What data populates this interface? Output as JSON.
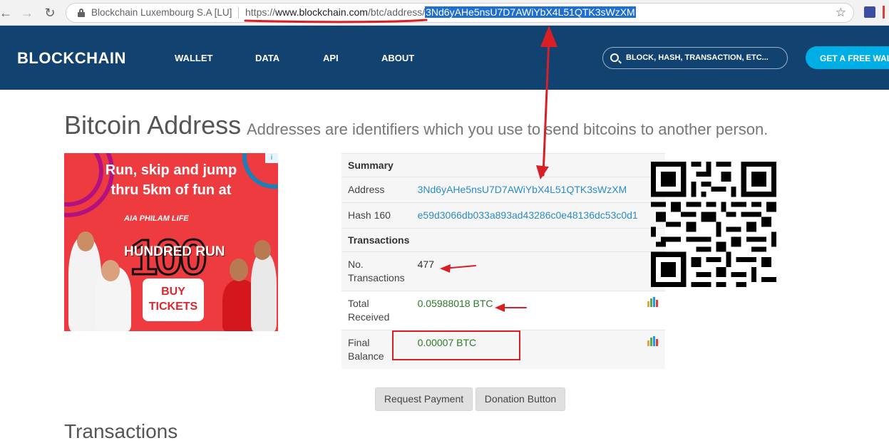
{
  "browser": {
    "site_identity": "Blockchain Luxembourg S.A [LU]",
    "url_scheme": "https://",
    "url_host": "www.blockchain.com",
    "url_path": "/btc/address/",
    "url_selected": "3Nd6yAHe5nsU7D7AWiYbX4L51QTK3sWzXM",
    "back_glyph": "←",
    "forward_glyph": "→",
    "reload_glyph": "↻",
    "star_glyph": "☆"
  },
  "header": {
    "brand": "BLOCKCHAIN",
    "nav": [
      "WALLET",
      "DATA",
      "API",
      "ABOUT"
    ],
    "search_placeholder": "BLOCK, HASH, TRANSACTION, ETC...",
    "cta": "GET A FREE WALLET",
    "bg_color": "#114270",
    "cta_color": "#00aee6"
  },
  "page": {
    "title": "Bitcoin Address",
    "subtitle": "Addresses are identifiers which you use to send bitcoins to another person.",
    "next_heading": "Transactions"
  },
  "ad": {
    "headline_1": "Run, skip and jump",
    "headline_2": "thru 5km of fun at",
    "brand": "AIA PHILAM LIFE",
    "number": "100",
    "event": "HUNDRED RUN",
    "cta_1": "BUY",
    "cta_2": "TICKETS",
    "adchoices": "i"
  },
  "summary": {
    "header": "Summary",
    "address_label": "Address",
    "address_value": "3Nd6yAHe5nsU7D7AWiYbX4L51QTK3sWzXM",
    "hash_label": "Hash 160",
    "hash_value": "e59d3066db033a893ad43286c0e48136dc53c0d1",
    "transactions_header": "Transactions",
    "no_tx_label_1": "No.",
    "no_tx_label_2": "Transactions",
    "no_tx_value": "477",
    "total_received_label_1": "Total",
    "total_received_label_2": "Received",
    "total_received_value": "0.05988018 BTC",
    "final_balance_label_1": "Final",
    "final_balance_label_2": "Balance",
    "final_balance_value": "0.00007 BTC"
  },
  "buttons": {
    "request_payment": "Request Payment",
    "donation": "Donation Button"
  },
  "annotation_color": "#d81f26"
}
